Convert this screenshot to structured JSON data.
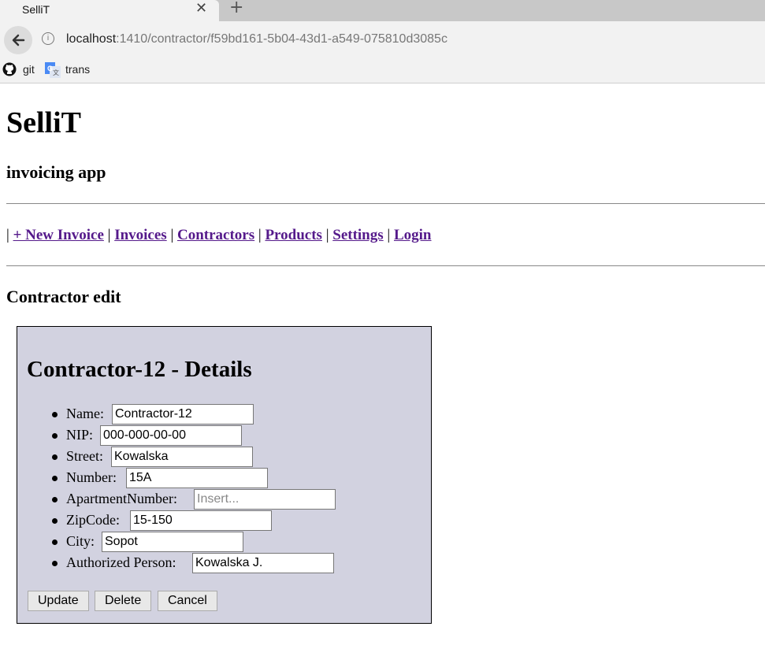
{
  "browser": {
    "tab_title": "SelliT",
    "close_glyph": "✕",
    "new_tab_glyph": "+",
    "url_host": "localhost",
    "url_rest": ":1410/contractor/f59bd161-5b04-43d1-a549-075810d3085c",
    "bookmarks": [
      {
        "label": "git",
        "icon": "github-icon"
      },
      {
        "label": "trans",
        "icon": "google-translate-icon"
      }
    ]
  },
  "page": {
    "app_title": "SelliT",
    "subtitle": "invoicing app",
    "nav": {
      "separator": "|",
      "links": [
        "+ New Invoice",
        "Invoices",
        "Contractors",
        "Products",
        "Settings",
        "Login"
      ]
    },
    "section_title": "Contractor edit"
  },
  "form": {
    "title": "Contractor-12 - Details",
    "fields": [
      {
        "label": "Name:",
        "value": "Contractor-12",
        "placeholder": ""
      },
      {
        "label": "NIP:",
        "value": "000-000-00-00",
        "placeholder": ""
      },
      {
        "label": "Street:",
        "value": "Kowalska",
        "placeholder": ""
      },
      {
        "label": "Number:",
        "value": "15A",
        "placeholder": ""
      },
      {
        "label": "ApartmentNumber:",
        "value": "",
        "placeholder": "Insert..."
      },
      {
        "label": "ZipCode:",
        "value": "15-150",
        "placeholder": ""
      },
      {
        "label": "City:",
        "value": "Sopot",
        "placeholder": ""
      },
      {
        "label": "Authorized Person:",
        "value": "Kowalska J.",
        "placeholder": ""
      }
    ],
    "buttons": {
      "update": "Update",
      "delete": "Delete",
      "cancel": "Cancel"
    }
  }
}
